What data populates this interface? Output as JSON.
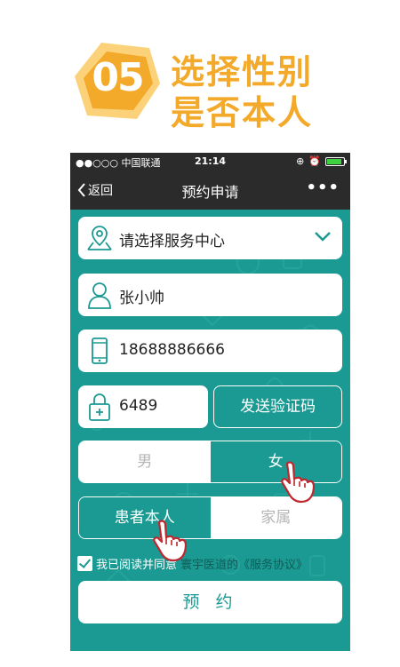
{
  "promo": {
    "step_number": "05",
    "line1": "选择性别",
    "line2": "是否本人"
  },
  "statusbar": {
    "carrier": "●●○○○ 中国联通",
    "time": "21:14",
    "battery_level": 0.9
  },
  "navbar": {
    "back_label": "返回",
    "title": "预约申请",
    "more": "•••"
  },
  "form": {
    "service_center_placeholder": "请选择服务中心",
    "name_value": "张小帅",
    "phone_value": "18688886666",
    "code_value": "6489",
    "send_code_label": "发送验证码",
    "gender": {
      "options": [
        "男",
        "女"
      ],
      "selected": "女"
    },
    "relation": {
      "options": [
        "患者本人",
        "家属"
      ],
      "selected": "患者本人"
    },
    "agreement": {
      "text": "我已阅读并同意",
      "link": "寰宇医道的《服务协议》",
      "checked": true
    },
    "submit_label": "预 约"
  },
  "colors": {
    "accent": "#1a9a92",
    "header_bar": "#2b2b2b",
    "promo_orange": "#f3a92a",
    "promo_badge_light": "#fbd27a"
  }
}
